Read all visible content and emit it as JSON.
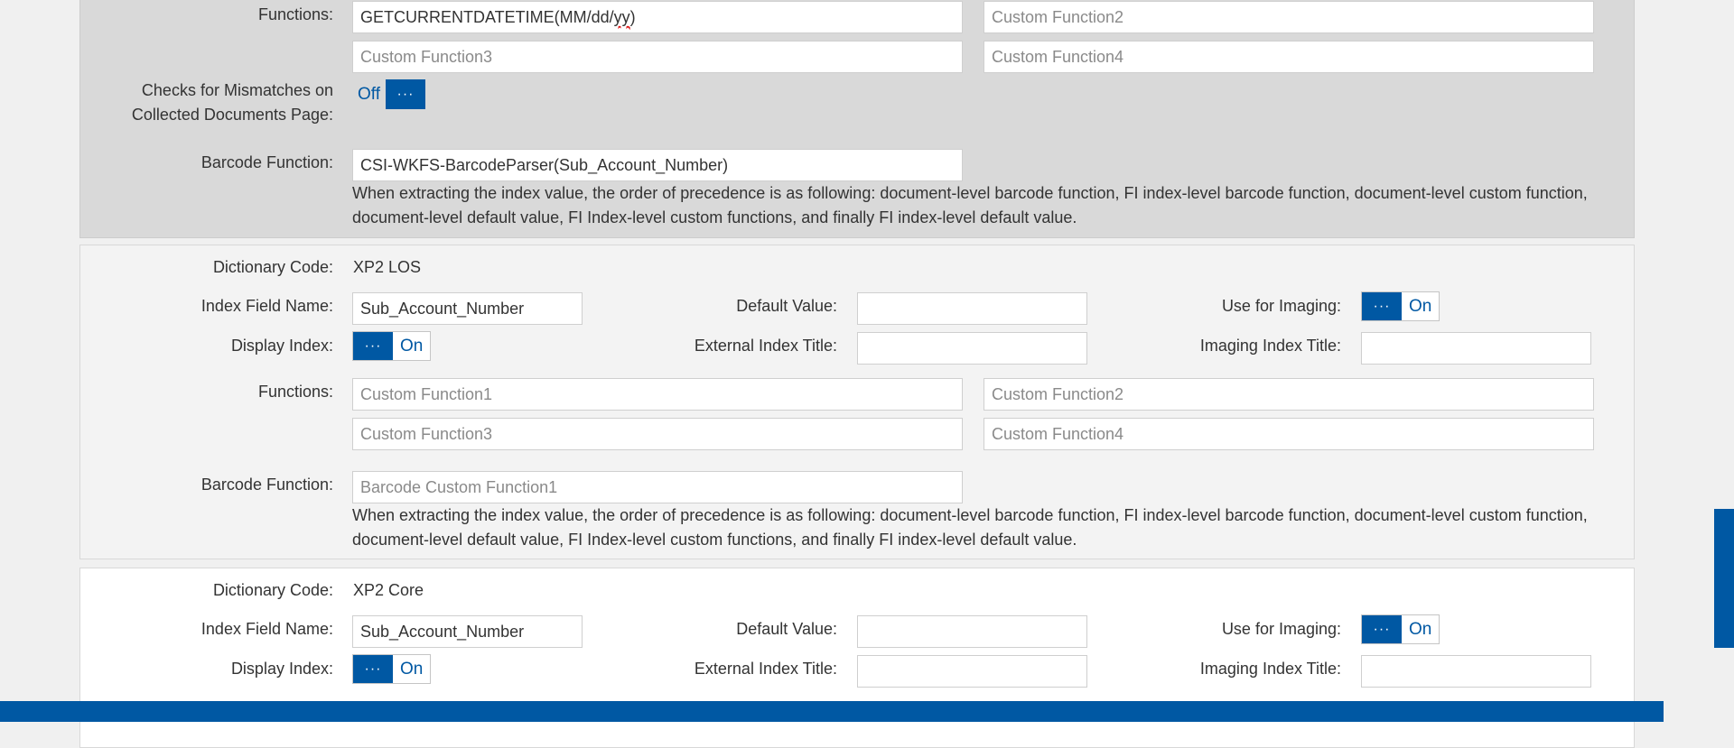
{
  "sections": [
    {
      "functions_label": "Functions:",
      "functions": [
        {
          "value": "GETCURRENTDATETIME(MM/dd/",
          "value_misspelled": "yy",
          "value_tail": ")",
          "placeholder": ""
        },
        {
          "value": "",
          "placeholder": "Custom Function2"
        },
        {
          "value": "",
          "placeholder": "Custom Function3"
        },
        {
          "value": "",
          "placeholder": "Custom Function4"
        }
      ],
      "mismatch_label_line1": "Checks for Mismatches on",
      "mismatch_label_line2": "Collected Documents Page:",
      "mismatch_toggle_state": "Off",
      "barcode_label": "Barcode Function:",
      "barcode_value": "CSI-WKFS-BarcodeParser(Sub_Account_Number)",
      "note_line1": "When extracting the index value, the order of precedence is as following: document-level barcode function, FI index-level barcode function, document-level custom function,",
      "note_line2": "document-level default value, FI Index-level custom functions, and finally FI index-level default value."
    },
    {
      "dictionary_label": "Dictionary Code:",
      "dictionary_value": "XP2 LOS",
      "index_field_label": "Index Field Name:",
      "index_field_value": "Sub_Account_Number",
      "default_value_label": "Default Value:",
      "default_value": "",
      "use_imaging_label": "Use for Imaging:",
      "use_imaging_state": "On",
      "display_index_label": "Display Index:",
      "display_index_state": "On",
      "external_title_label": "External Index Title:",
      "external_title_value": "",
      "imaging_title_label": "Imaging Index Title:",
      "imaging_title_value": "",
      "functions_label": "Functions:",
      "functions": [
        {
          "placeholder": "Custom Function1"
        },
        {
          "placeholder": "Custom Function2"
        },
        {
          "placeholder": "Custom Function3"
        },
        {
          "placeholder": "Custom Function4"
        }
      ],
      "barcode_label": "Barcode Function:",
      "barcode_placeholder": "Barcode Custom Function1",
      "note_line1": "When extracting the index value, the order of precedence is as following: document-level barcode function, FI index-level barcode function, document-level custom function,",
      "note_line2": "document-level default value, FI Index-level custom functions, and finally FI index-level default value."
    },
    {
      "dictionary_label": "Dictionary Code:",
      "dictionary_value": "XP2 Core",
      "index_field_label": "Index Field Name:",
      "index_field_value": "Sub_Account_Number",
      "default_value_label": "Default Value:",
      "default_value": "",
      "use_imaging_label": "Use for Imaging:",
      "use_imaging_state": "On",
      "display_index_label": "Display Index:",
      "display_index_state": "On",
      "external_title_label": "External Index Title:",
      "external_title_value": "",
      "imaging_title_label": "Imaging Index Title:",
      "imaging_title_value": ""
    }
  ],
  "toggle_knob_glyph": "···",
  "colors": {
    "accent": "#0058a3",
    "panel_grey": "#d9d9d9",
    "panel_light": "#f3f3f3"
  }
}
